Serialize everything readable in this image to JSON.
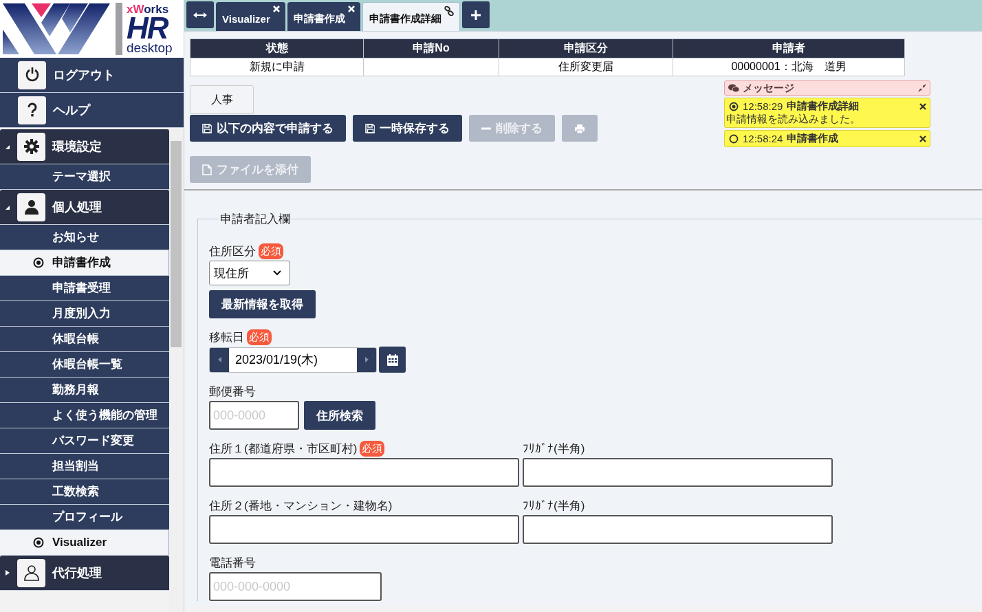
{
  "logo": {
    "brand_accent": "xW",
    "brand_rest": "orks",
    "product": "HR",
    "edition": "desktop"
  },
  "sidebar": {
    "top_items": [
      {
        "label": "ログアウト",
        "kind": "power"
      },
      {
        "label": "ヘルプ",
        "kind": "help"
      }
    ],
    "groups": [
      {
        "label": "環境設定",
        "kind": "gear",
        "expanded": true,
        "items": [
          {
            "label": "テーマ選択",
            "selected": false
          }
        ]
      },
      {
        "label": "個人処理",
        "kind": "person",
        "expanded": true,
        "items": [
          {
            "label": "お知らせ",
            "selected": false
          },
          {
            "label": "申請書作成",
            "selected": true
          },
          {
            "label": "申請書受理",
            "selected": false
          },
          {
            "label": "月度別入力",
            "selected": false
          },
          {
            "label": "休暇台帳",
            "selected": false
          },
          {
            "label": "休暇台帳一覧",
            "selected": false
          },
          {
            "label": "勤務月報",
            "selected": false
          },
          {
            "label": "よく使う機能の管理",
            "selected": false
          },
          {
            "label": "パスワード変更",
            "selected": false
          },
          {
            "label": "担当割当",
            "selected": false
          },
          {
            "label": "工数検索",
            "selected": false
          },
          {
            "label": "プロフィール",
            "selected": false
          },
          {
            "label": "Visualizer",
            "selected": true
          }
        ]
      },
      {
        "label": "代行処理",
        "kind": "person-outline",
        "expanded": false
      }
    ]
  },
  "tabs": [
    {
      "label": "Visualizer",
      "selected": false,
      "kind": "closable"
    },
    {
      "label": "申請書作成",
      "selected": false,
      "kind": "closable"
    },
    {
      "label": "申請書作成詳細",
      "selected": true,
      "kind": "linked"
    }
  ],
  "summary": {
    "columns": [
      "状態",
      "申請No",
      "申請区分",
      "申請者"
    ],
    "cells": [
      "新規に申請",
      null,
      "住所変更届",
      "00000001：北海　道男"
    ]
  },
  "section_tab": {
    "label": "人事"
  },
  "actions": [
    {
      "label": "以下の内容で申請する",
      "kind": "save",
      "disabled": false
    },
    {
      "label": "一時保存する",
      "kind": "save",
      "disabled": false
    },
    {
      "label": "削除する",
      "kind": "minus",
      "disabled": true
    },
    {
      "kind": "print",
      "disabled": true
    }
  ],
  "attach": {
    "label": "ファイルを添付",
    "disabled": true
  },
  "messages": {
    "title": "メッセージ",
    "items": [
      {
        "time": "12:58:29",
        "source": "申請書作成詳細",
        "text": "申請情報を読み込みました。",
        "active": true
      },
      {
        "time": "12:58:24",
        "source": "申請書作成",
        "active": false
      }
    ]
  },
  "form": {
    "legend": "申請者記入欄",
    "fields": [
      {
        "kind": "select",
        "label": "住所区分",
        "badge": "必須",
        "value": "現住所",
        "button": "最新情報を取得"
      },
      {
        "kind": "date",
        "label": "移転日",
        "badge": "必須",
        "value": "2023/01/19(木)"
      },
      {
        "kind": "text",
        "label": "郵便番号",
        "placeholder": "000-0000",
        "button": "住所検索"
      },
      {
        "kind": "pair",
        "label": "住所１(都道府県・市区町村)",
        "badge": "必須",
        "kana_label": "ﾌﾘｶﾞﾅ(半角)"
      },
      {
        "kind": "pair",
        "label": "住所２(番地・マンション・建物名)",
        "kana_label": "ﾌﾘｶﾞﾅ(半角)"
      },
      {
        "kind": "tel",
        "label": "電話番号",
        "placeholder": "000-000-0000"
      }
    ]
  }
}
